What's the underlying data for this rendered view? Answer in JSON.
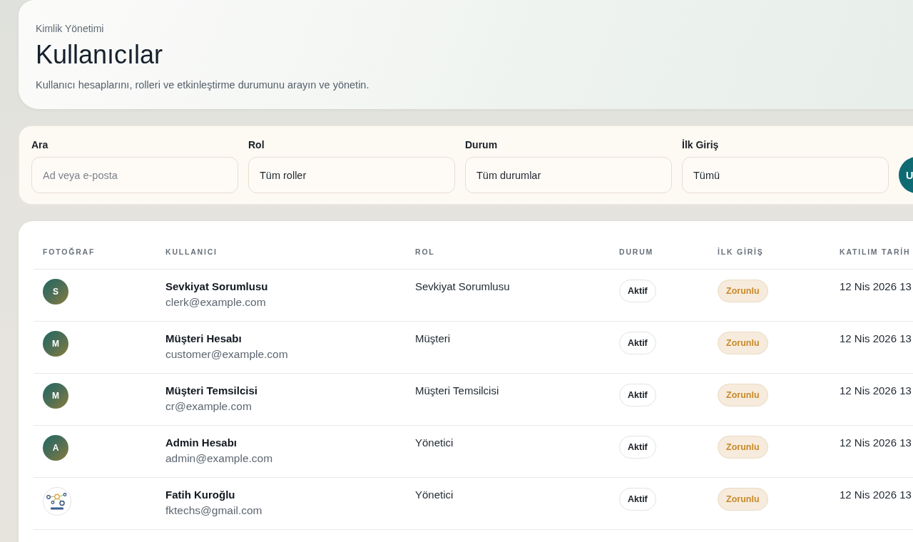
{
  "header": {
    "eyebrow": "Kimlik Yönetimi",
    "title": "Kullanıcılar",
    "description": "Kullanıcı hesaplarını, rolleri ve etkinleştirme durumunu arayın ve yönetin."
  },
  "filters": [
    {
      "label": "Ara",
      "kind": "text",
      "placeholder": "Ad veya e-posta"
    },
    {
      "label": "Rol",
      "kind": "select",
      "value": "Tüm roller"
    },
    {
      "label": "Durum",
      "kind": "select",
      "value": "Tüm durumlar"
    },
    {
      "label": "İlk Giriş",
      "kind": "select",
      "value": "Tümü"
    }
  ],
  "apply_button": {
    "label": "U"
  },
  "table": {
    "columns": [
      "FOTOĞRAF",
      "KULLANICI",
      "ROL",
      "DURUM",
      "İLK GİRİŞ",
      "KATILIM TARİH"
    ],
    "rows": [
      {
        "avatar": {
          "kind": "initial",
          "text": "S"
        },
        "name": "Sevkiyat Sorumlusu",
        "email": "clerk@example.com",
        "role": "Sevkiyat Sorumlusu",
        "status": "Aktif",
        "first_login": "Zorunlu",
        "joined": "12 Nis 2026 13"
      },
      {
        "avatar": {
          "kind": "initial",
          "text": "M"
        },
        "name": "Müşteri Hesabı",
        "email": "customer@example.com",
        "role": "Müşteri",
        "status": "Aktif",
        "first_login": "Zorunlu",
        "joined": "12 Nis 2026 13"
      },
      {
        "avatar": {
          "kind": "initial",
          "text": "M"
        },
        "name": "Müşteri Temsilcisi",
        "email": "cr@example.com",
        "role": "Müşteri Temsilcisi",
        "status": "Aktif",
        "first_login": "Zorunlu",
        "joined": "12 Nis 2026 13"
      },
      {
        "avatar": {
          "kind": "initial",
          "text": "A"
        },
        "name": "Admin Hesabı",
        "email": "admin@example.com",
        "role": "Yönetici",
        "status": "Aktif",
        "first_login": "Zorunlu",
        "joined": "12 Nis 2026 13"
      },
      {
        "avatar": {
          "kind": "logo"
        },
        "name": "Fatih Kuroğlu",
        "email": "fktechs@gmail.com",
        "role": "Yönetici",
        "status": "Aktif",
        "first_login": "Zorunlu",
        "joined": "12 Nis 2026 13"
      }
    ]
  }
}
